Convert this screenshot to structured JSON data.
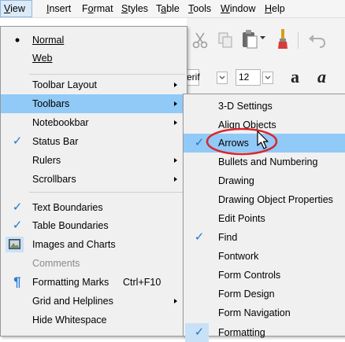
{
  "menubar": {
    "items": [
      "View",
      "Insert",
      "Format",
      "Styles",
      "Table",
      "Tools",
      "Window",
      "Help"
    ]
  },
  "toolbar": {
    "font_name_partial": "Serif",
    "font_size": "12"
  },
  "view_menu": {
    "items": [
      {
        "label": "Normal",
        "check": "•"
      },
      {
        "label": "Web"
      },
      {
        "label": "Toolbar Layout",
        "submenu": true
      },
      {
        "label": "Toolbars",
        "submenu": true,
        "highlighted": true
      },
      {
        "label": "Notebookbar",
        "submenu": true
      },
      {
        "label": "Status Bar",
        "check": "✓"
      },
      {
        "label": "Rulers",
        "submenu": true
      },
      {
        "label": "Scrollbars",
        "submenu": true
      },
      {
        "label": "Text Boundaries",
        "check": "✓"
      },
      {
        "label": "Table Boundaries",
        "check": "✓"
      },
      {
        "label": "Images and Charts",
        "icon": "image-chart-icon"
      },
      {
        "label": "Comments",
        "disabled": true
      },
      {
        "label": "Formatting Marks",
        "shortcut": "Ctrl+F10",
        "icon": "pilcrow-icon"
      },
      {
        "label": "Grid and Helplines",
        "submenu": true
      },
      {
        "label": "Hide Whitespace"
      }
    ]
  },
  "toolbars_submenu": {
    "items": [
      {
        "label": "3-D Settings"
      },
      {
        "label": "Align Objects"
      },
      {
        "label": "Arrows",
        "check": "✓",
        "highlighted": true
      },
      {
        "label": "Bullets and Numbering"
      },
      {
        "label": "Drawing"
      },
      {
        "label": "Drawing Object Properties"
      },
      {
        "label": "Edit Points"
      },
      {
        "label": "Find",
        "check": "✓"
      },
      {
        "label": "Fontwork"
      },
      {
        "label": "Form Controls"
      },
      {
        "label": "Form Design"
      },
      {
        "label": "Form Navigation"
      },
      {
        "label": "Formatting",
        "check": "✓"
      }
    ]
  },
  "colors": {
    "highlight": "#91c9f7",
    "check": "#1e78c8",
    "annotation_circle": "#d9262c"
  }
}
